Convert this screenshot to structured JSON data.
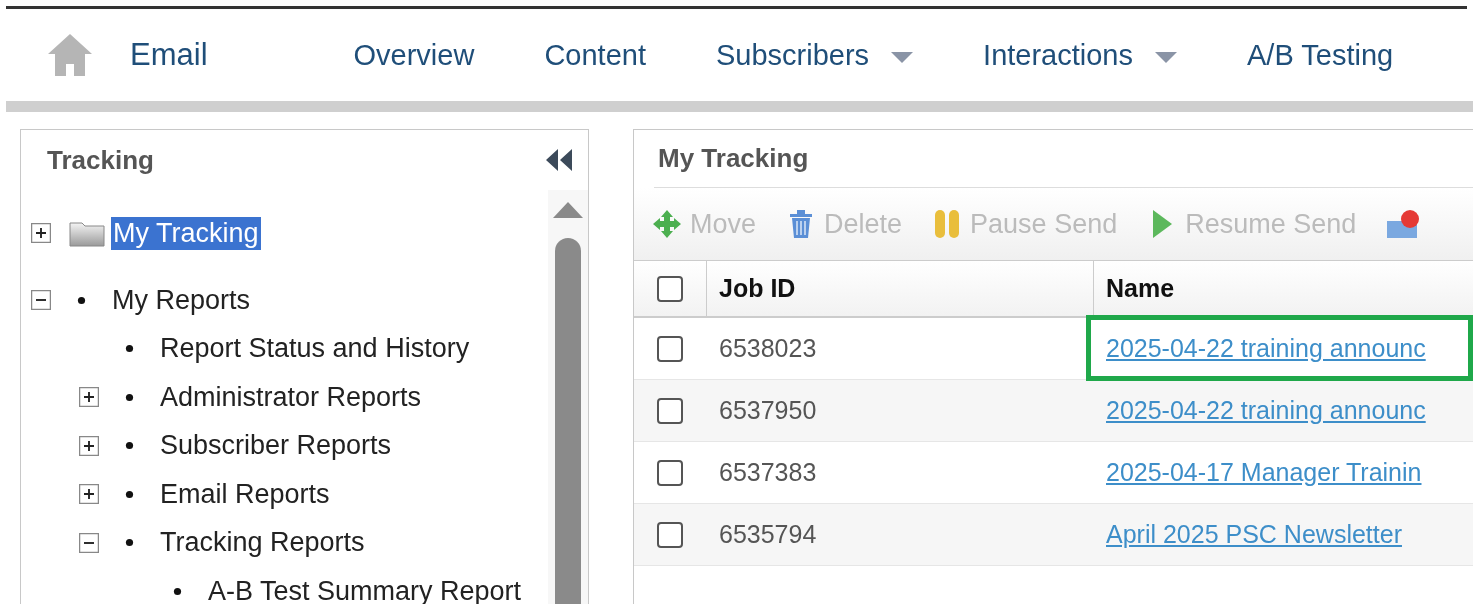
{
  "nav": {
    "title": "Email",
    "items": [
      {
        "label": "Overview",
        "dropdown": false
      },
      {
        "label": "Content",
        "dropdown": false
      },
      {
        "label": "Subscribers",
        "dropdown": true
      },
      {
        "label": "Interactions",
        "dropdown": true
      },
      {
        "label": "A/B Testing",
        "dropdown": false
      }
    ]
  },
  "sidebar": {
    "title": "Tracking",
    "tree": [
      {
        "label": "My Tracking",
        "kind": "folder",
        "expanded": false,
        "selected": true
      },
      {
        "label": "My Reports",
        "kind": "report",
        "expanded": true,
        "selected": false,
        "children": [
          {
            "label": "Report Status and History",
            "kind": "report",
            "selected": false
          },
          {
            "label": "Administrator Reports",
            "kind": "report",
            "expanded": false,
            "selected": false
          },
          {
            "label": "Subscriber Reports",
            "kind": "report",
            "expanded": false,
            "selected": false
          },
          {
            "label": "Email Reports",
            "kind": "report",
            "expanded": false,
            "selected": false
          },
          {
            "label": "Tracking Reports",
            "kind": "report",
            "expanded": true,
            "selected": false,
            "children": [
              {
                "label": "A-B Test Summary Report",
                "kind": "report",
                "selected": false
              }
            ]
          }
        ]
      }
    ]
  },
  "main": {
    "title": "My Tracking",
    "toolbar": [
      {
        "label": "Move",
        "kind": "move",
        "disabled": true
      },
      {
        "label": "Delete",
        "kind": "delete",
        "disabled": true
      },
      {
        "label": "Pause Send",
        "kind": "pause",
        "disabled": true
      },
      {
        "label": "Resume Send",
        "kind": "resume",
        "disabled": true
      },
      {
        "kind": "cancel"
      }
    ],
    "table": {
      "columns": [
        "Job ID",
        "Name"
      ],
      "header_checked": false,
      "rows": [
        {
          "job_id": "6538023",
          "name": "2025-04-22 training announc",
          "checked": false,
          "highlighted": true
        },
        {
          "job_id": "6537950",
          "name": "2025-04-22 training announc",
          "checked": false,
          "highlighted": false
        },
        {
          "job_id": "6537383",
          "name": "2025-04-17 Manager Trainin",
          "checked": false,
          "highlighted": false
        },
        {
          "job_id": "6535794",
          "name": "April 2025 PSC Newsletter",
          "checked": false,
          "highlighted": false
        }
      ]
    }
  }
}
